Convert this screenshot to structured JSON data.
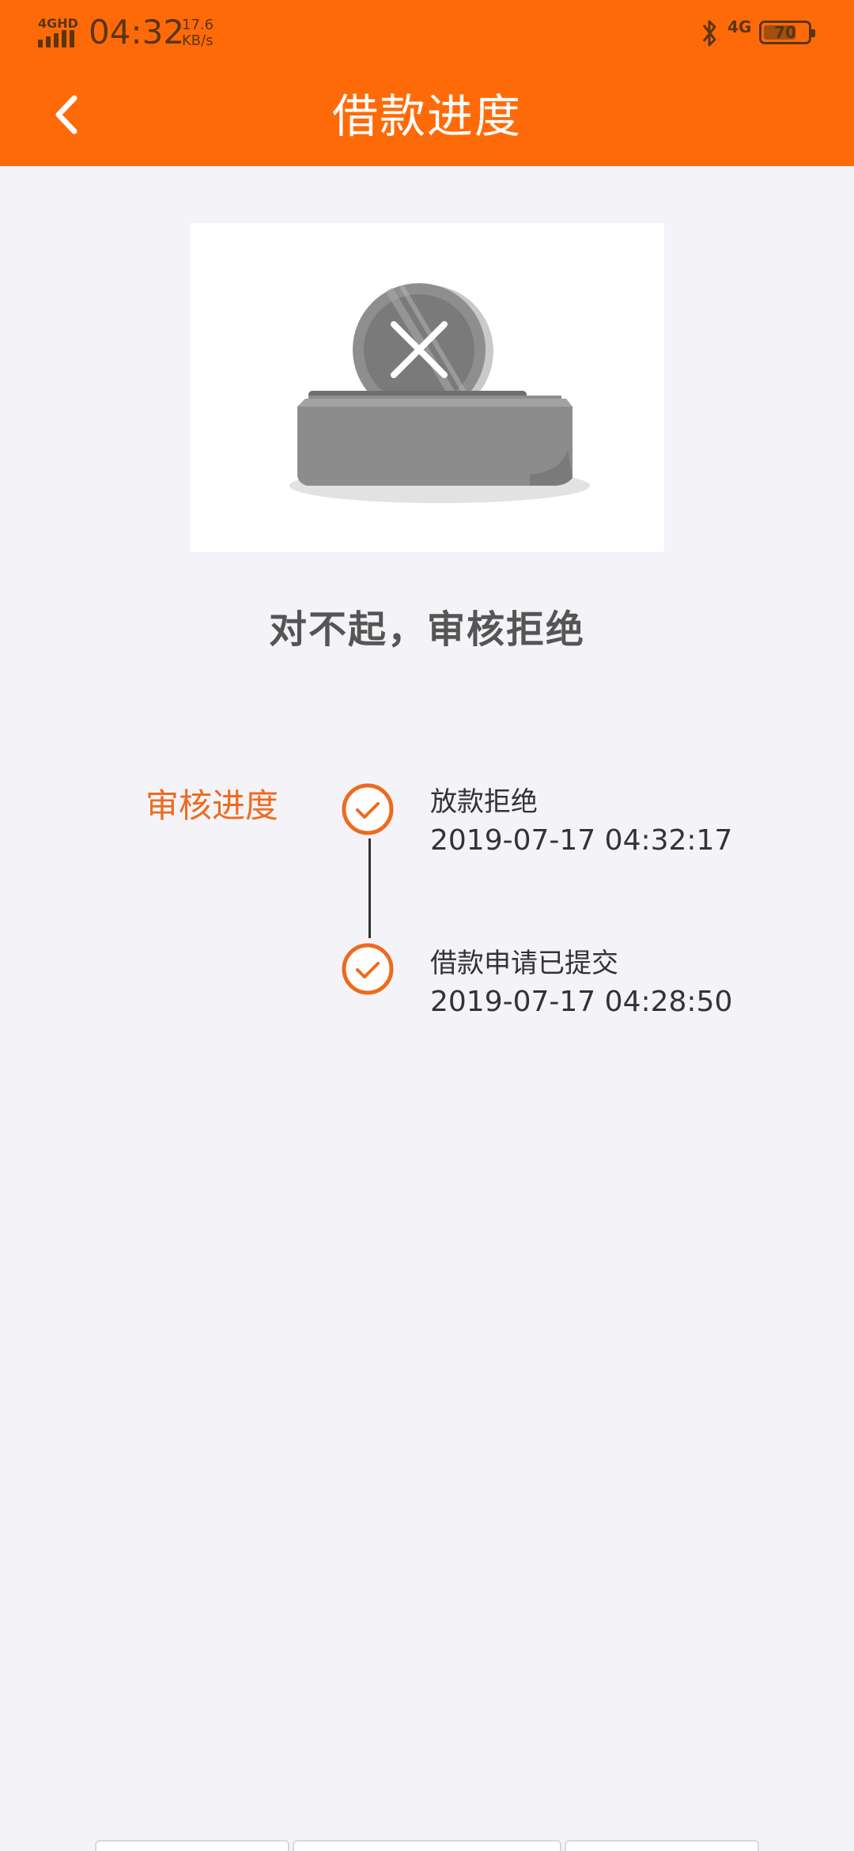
{
  "status_bar": {
    "network": "4GHD",
    "time": "04:32",
    "speed_value": "17.6",
    "speed_unit": "KB/s",
    "cell_type": "4G",
    "battery": "70"
  },
  "header": {
    "title": "借款进度",
    "back_icon": "chevron-left-icon",
    "color": "#ff6a08"
  },
  "hero": {
    "icon": "rejected-coin-box-illustration"
  },
  "result": {
    "headline": "对不起，审核拒绝"
  },
  "progress": {
    "label": "审核进度",
    "accent": "#ef6a1e",
    "steps": [
      {
        "title": "放款拒绝",
        "time": "2019-07-17 04:32:17",
        "icon": "check-circle-icon"
      },
      {
        "title": "借款申请已提交",
        "time": "2019-07-17 04:28:50",
        "icon": "check-circle-icon"
      }
    ]
  }
}
